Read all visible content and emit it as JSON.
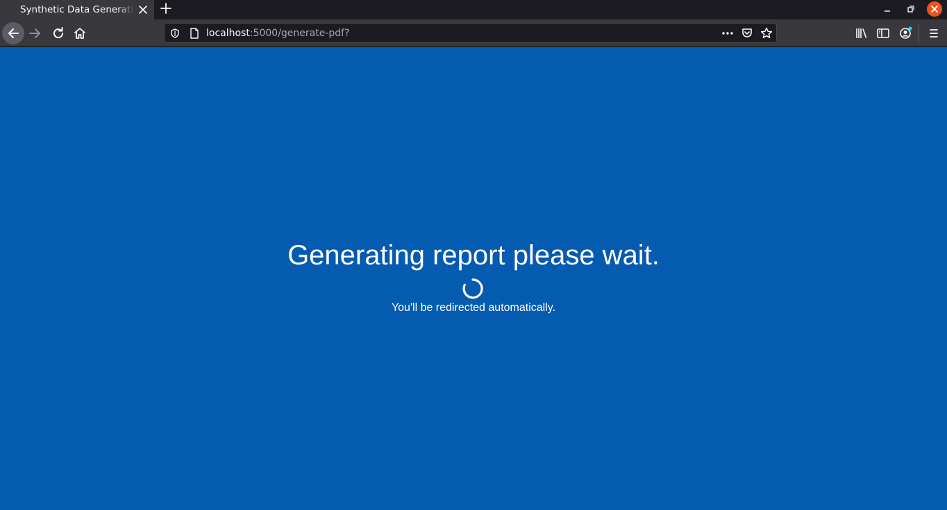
{
  "browser": {
    "tab": {
      "title": "Synthetic Data Generation"
    },
    "url": {
      "host": "localhost",
      "rest": ":5000/generate-pdf?"
    },
    "icons": {
      "back": "arrow-left-icon",
      "forward": "arrow-right-icon",
      "reload": "reload-icon",
      "home": "home-icon",
      "shield": "tracking-protection-shield-icon",
      "page": "page-info-icon",
      "more": "more-actions-icon",
      "pocket": "pocket-icon",
      "bookmark": "star-icon",
      "library": "library-icon",
      "sidebar": "sidebar-icon",
      "account": "account-icon",
      "menu": "hamburger-menu-icon"
    },
    "colors": {
      "toolbar": "#38383d",
      "tabstrip": "#1c1b22",
      "close_button": "#e95420",
      "account_badge": "#00ddff"
    }
  },
  "page": {
    "heading": "Generating report please wait.",
    "subtext": "You'll be redirected automatically.",
    "background_color": "#055bb0",
    "spinner": "loading-spinner-icon"
  }
}
